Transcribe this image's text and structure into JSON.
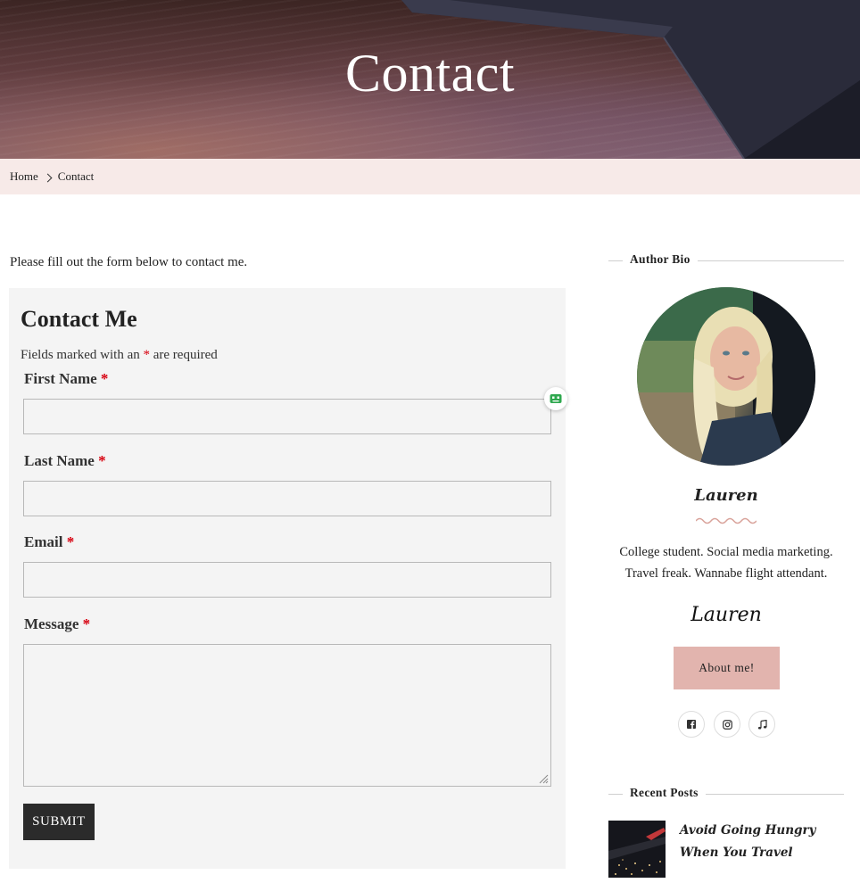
{
  "hero": {
    "title": "Contact"
  },
  "breadcrumb": {
    "home": "Home",
    "current": "Contact"
  },
  "main": {
    "intro": "Please fill out the form below to contact me.",
    "form": {
      "title": "Contact Me",
      "required_note_before": "Fields marked with an",
      "required_mark": "*",
      "required_note_after": "are required",
      "fields": [
        {
          "label": "First Name",
          "value": "",
          "type": "text"
        },
        {
          "label": "Last Name",
          "value": "",
          "type": "text"
        },
        {
          "label": "Email",
          "value": "",
          "type": "email"
        },
        {
          "label": "Message",
          "value": "",
          "type": "textarea"
        }
      ],
      "submit_label": "SUBMIT"
    }
  },
  "sidebar": {
    "author_widget": {
      "title": "Author Bio",
      "name": "Lauren",
      "description_line1": "College student. Social media marketing.",
      "description_line2": "Travel freak. Wannabe flight attendant.",
      "signature": "Lauren",
      "button_label": "About me!",
      "socials": [
        {
          "icon": "facebook-icon"
        },
        {
          "icon": "instagram-icon"
        },
        {
          "icon": "music-note-icon"
        }
      ]
    },
    "recent_posts": {
      "title": "Recent Posts",
      "posts": [
        {
          "title": "Avoid Going Hungry When You Travel"
        }
      ]
    }
  },
  "colors": {
    "breadcrumb_bg": "#f7eae8",
    "form_bg": "#f4f4f4",
    "required": "#d7000f",
    "submit_bg": "#2b2b2b",
    "about_button_bg": "#e2b4ae",
    "squiggle": "#d9a39b"
  }
}
